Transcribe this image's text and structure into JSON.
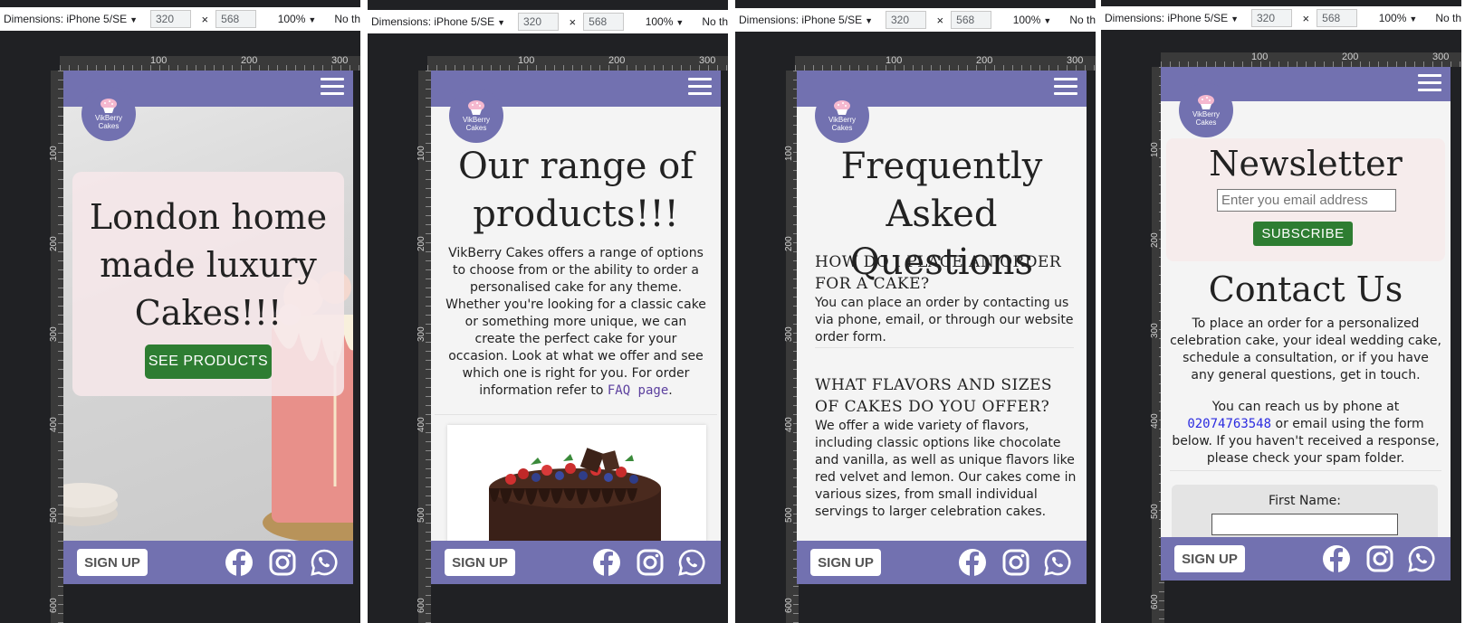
{
  "devtools": {
    "dimensions_label": "Dimensions: iPhone 5/SE",
    "width_value": "320",
    "times": "×",
    "height_value": "568",
    "zoom": "100%",
    "throttle": "No th",
    "ruler_h": [
      "100",
      "200",
      "300"
    ],
    "ruler_v": [
      "100",
      "200",
      "300",
      "400",
      "500",
      "600"
    ]
  },
  "brand": {
    "logo_line1": "VikBerry",
    "logo_line2": "Cakes",
    "accent": "#7271b0",
    "button_green": "#2e7d32"
  },
  "footer": {
    "signup_label": "SIGN UP",
    "icons": [
      "facebook-icon",
      "instagram-icon",
      "whatsapp-icon"
    ]
  },
  "home": {
    "title_lines": [
      "London home",
      "made luxury",
      "Cakes!!!"
    ],
    "cta_label": "SEE PRODUCTS"
  },
  "products": {
    "title_lines": [
      "Our range of",
      "products!!!"
    ],
    "description": "VikBerry Cakes offers a range of options to choose from or the ability to order a personalised cake for any theme. Whether you're looking for a classic cake or something more unique, we can create the perfect cake for your occasion. Look at what we offer and see which one is right for you. For order information refer to",
    "faq_link": "FAQ page",
    "period": "."
  },
  "faq": {
    "title_lines": [
      "Frequently",
      "Asked Questions"
    ],
    "items": [
      {
        "question": "HOW DO I PLACE AN ORDER FOR A CAKE?",
        "answer": "You can place an order by contacting us via phone, email, or through our website order form."
      },
      {
        "question": "WHAT FLAVORS AND SIZES OF CAKES DO YOU OFFER?",
        "answer": "We offer a wide variety of flavors, including classic options like chocolate and vanilla, as well as unique flavors like red velvet and lemon. Our cakes come in various sizes, from small individual servings to larger celebration cakes."
      }
    ]
  },
  "contact": {
    "newsletter_title": "Newsletter",
    "email_placeholder": "Enter you email address",
    "subscribe_label": "SUBSCRIBE",
    "title": "Contact Us",
    "intro": "To place an order for a personalized celebration cake, your ideal wedding cake, schedule a consultation, or if you have any general questions, get in touch.",
    "reach_prefix": "You can reach us by phone at",
    "phone": "02074763548",
    "reach_suffix": "or email using the form below. If you haven't received a response, please check your spam folder.",
    "first_name_label": "First Name:"
  }
}
